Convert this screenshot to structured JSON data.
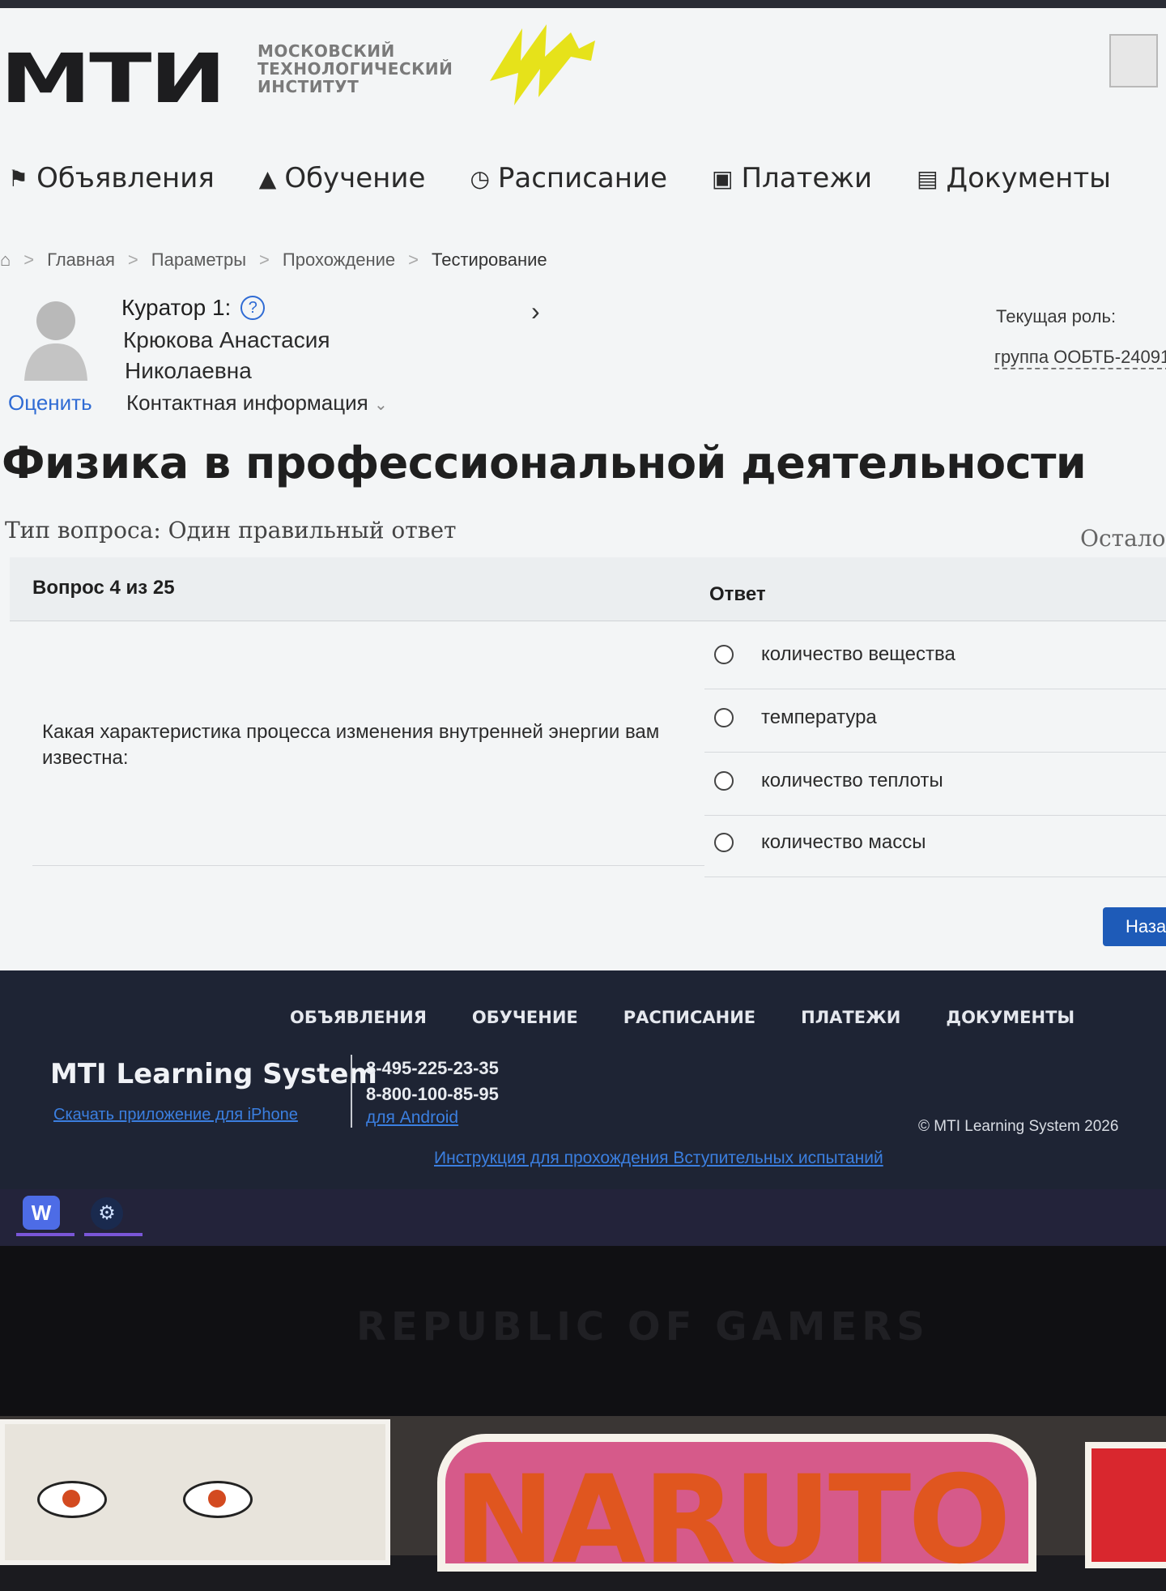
{
  "brand": {
    "logo": "МТИ",
    "logo_lines": [
      "МОСКОВСКИЙ",
      "ТЕХНОЛОГИЧЕСКИЙ",
      "ИНСТИТУТ"
    ],
    "accent_yellow": "#e6e21a"
  },
  "nav": [
    {
      "label": "Объявления",
      "icon": "megaphone-icon"
    },
    {
      "label": "Обучение",
      "icon": "graduation-cap-icon"
    },
    {
      "label": "Расписание",
      "icon": "clock-icon"
    },
    {
      "label": "Платежи",
      "icon": "card-icon"
    },
    {
      "label": "Документы",
      "icon": "document-icon"
    }
  ],
  "breadcrumb": [
    "Главная",
    "Параметры",
    "Прохождение",
    "Тестирование"
  ],
  "curator": {
    "label": "Куратор 1:",
    "name_line1": "Крюкова Анастасия",
    "name_line2": "Николаевна",
    "contact": "Контактная информация",
    "rate": "Оценить"
  },
  "role": {
    "label": "Текущая роль:",
    "value": "группа ООБТБ-24091"
  },
  "page_title": "Физика в профессиональной деятельности",
  "question_type": "Тип вопроса: Один правильный ответ",
  "remaining": "Осталос",
  "question": {
    "number": "Вопрос 4 из 25",
    "answer_header": "Ответ",
    "text": "Какая характеристика процесса изменения внутренней энергии вам известна:",
    "options": [
      "количество вещества",
      "температура",
      "количество теплоты",
      "количество массы"
    ]
  },
  "next_button": "Наза",
  "footer": {
    "nav": [
      "ОБЪЯВЛЕНИЯ",
      "ОБУЧЕНИЕ",
      "РАСПИСАНИЕ",
      "ПЛАТЕЖИ",
      "ДОКУМЕНТЫ"
    ],
    "brand": "MTI Learning System",
    "ios_link": "Скачать приложение для iPhone",
    "phone1": "8-495-225-23-35",
    "phone2": "8-800-100-85-95",
    "android_link": "для Android",
    "copyright": "© MTI Learning System 2026",
    "instructions": "Инструкция для прохождения Вступительных испытаний"
  },
  "taskbar": {
    "apps": [
      "messenger-app-icon",
      "steam-icon"
    ]
  },
  "bezel_text": "REPUBLIC OF GAMERS",
  "sticker_text": "NARUTO"
}
